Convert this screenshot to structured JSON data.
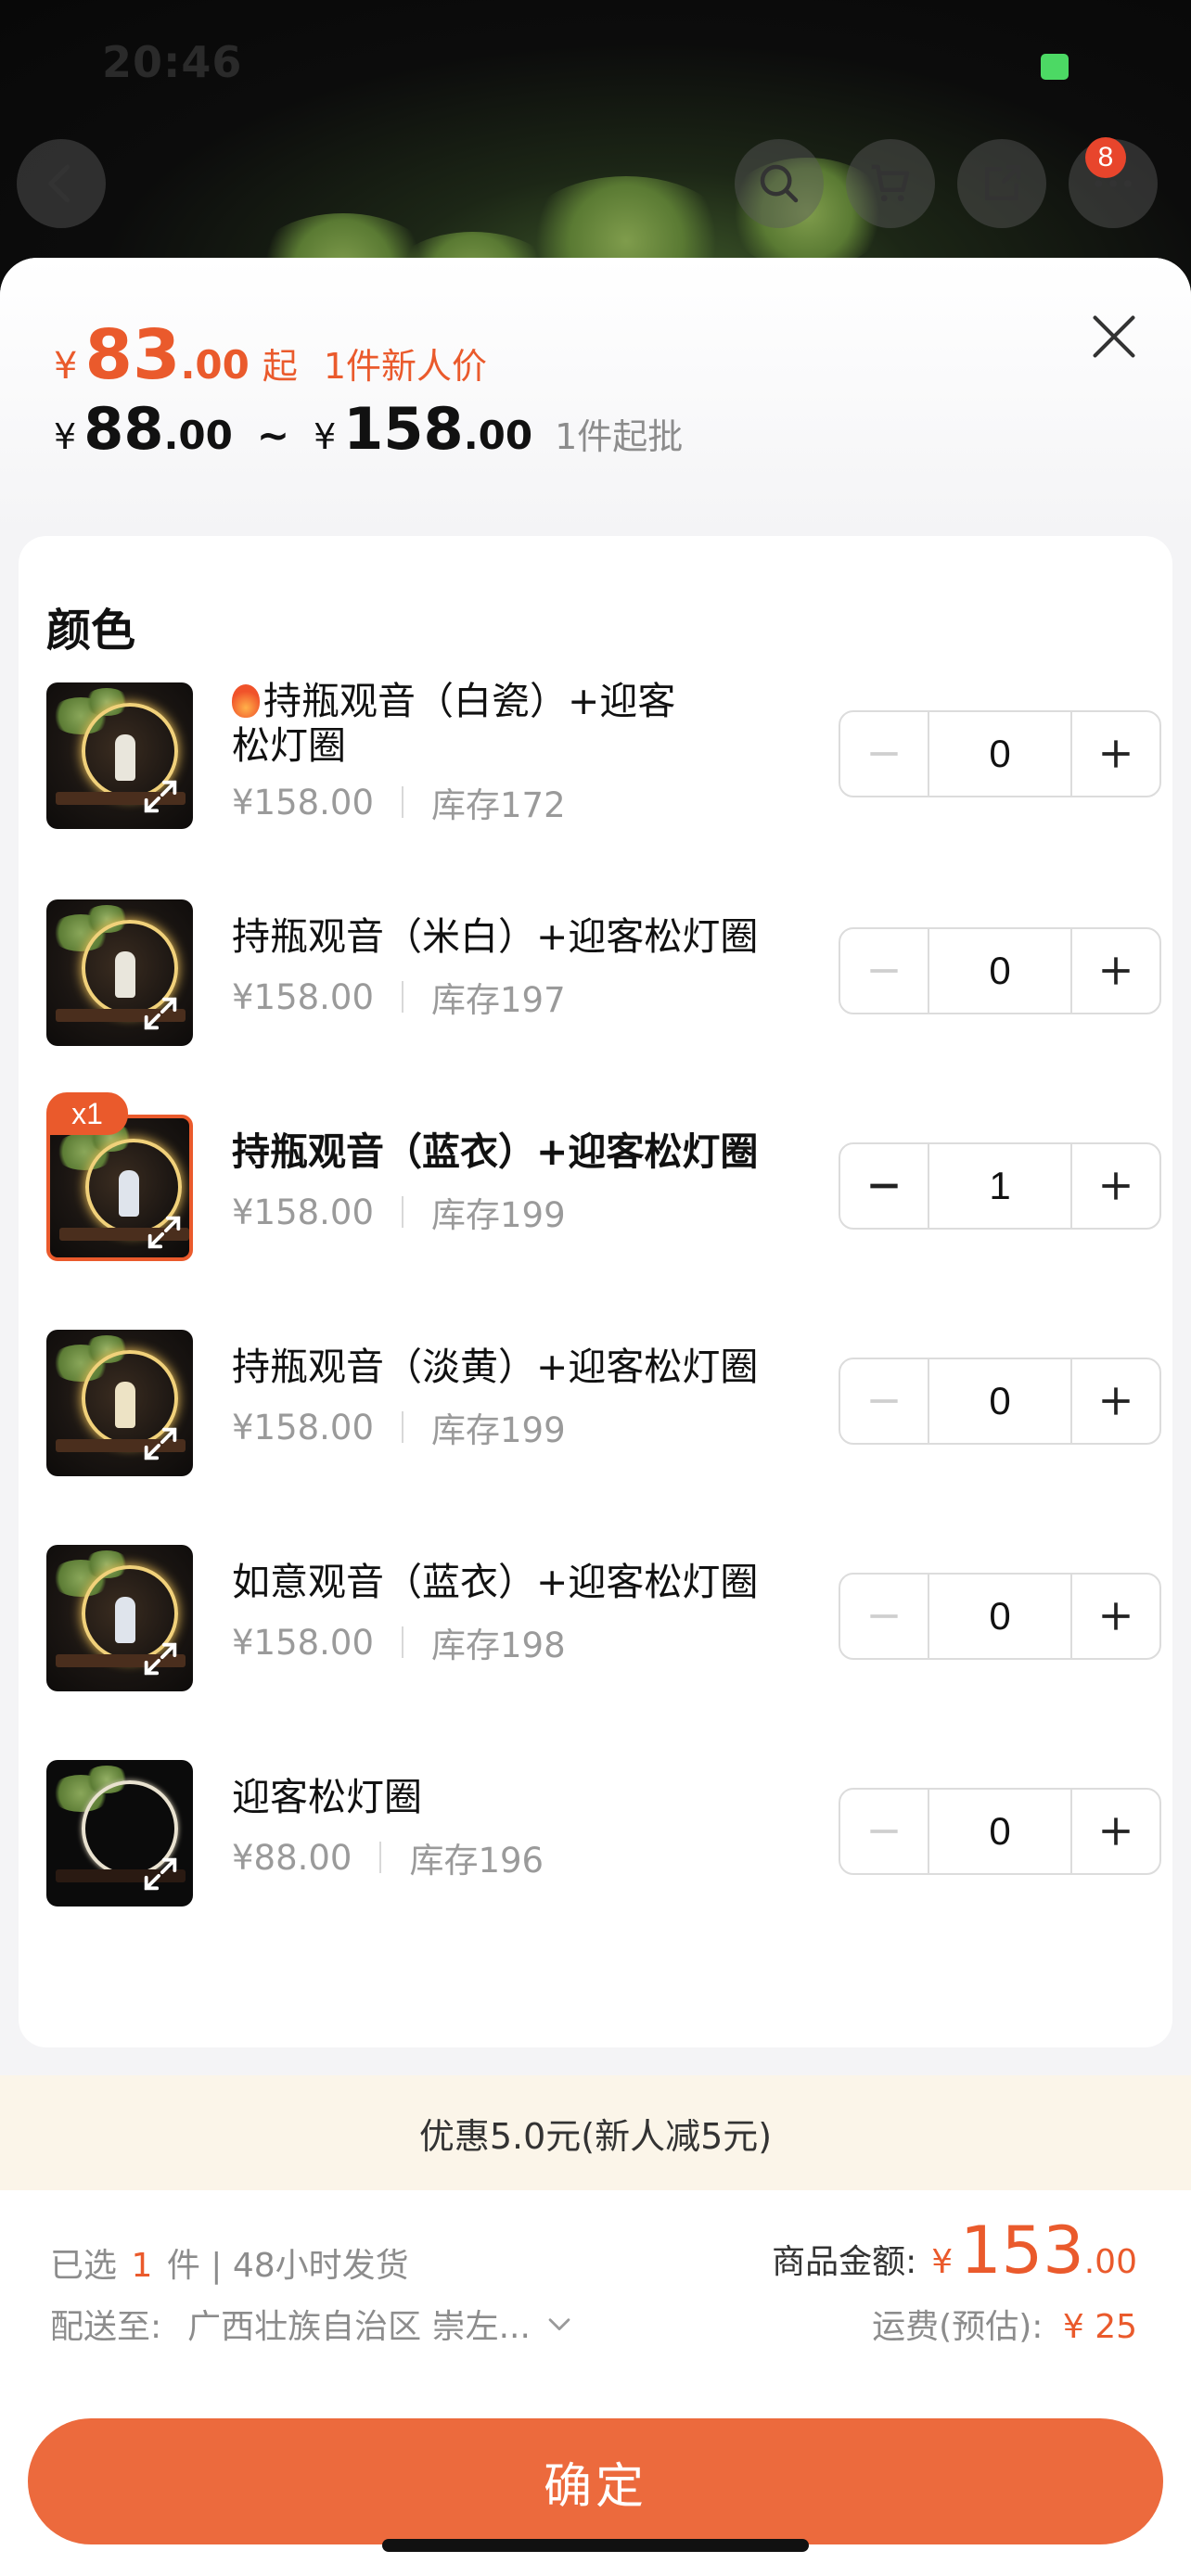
{
  "status_bar": {
    "time": "20:46"
  },
  "nav": {
    "cart_badge": "8"
  },
  "header": {
    "price_yen": "¥",
    "price_int": "83",
    "price_dec": ".00",
    "price_suffix": "起",
    "price_tag": "1件新人价",
    "range_yen1": "¥",
    "range_low_int": "88",
    "range_low_dec": ".00",
    "range_sep": "~",
    "range_yen2": "¥",
    "range_high_int": "158",
    "range_high_dec": ".00",
    "moq": "1件起批"
  },
  "section_title": "颜色",
  "variants": [
    {
      "name": "持瓶观音（白瓷）+迎客松灯圈",
      "price": "¥158.00",
      "stock": "库存172",
      "qty": "0",
      "hot": true
    },
    {
      "name": "持瓶观音（米白）+迎客松灯圈",
      "price": "¥158.00",
      "stock": "库存197",
      "qty": "0"
    },
    {
      "name": "持瓶观音（蓝衣）+迎客松灯圈",
      "price": "¥158.00",
      "stock": "库存199",
      "qty": "1",
      "badge": "x1",
      "selected": true
    },
    {
      "name": "持瓶观音（淡黄）+迎客松灯圈",
      "price": "¥158.00",
      "stock": "库存199",
      "qty": "0"
    },
    {
      "name": "如意观音（蓝衣）+迎客松灯圈",
      "price": "¥158.00",
      "stock": "库存198",
      "qty": "0"
    },
    {
      "name": "迎客松灯圈",
      "price": "¥88.00",
      "stock": "库存196",
      "qty": "0"
    }
  ],
  "discount": "优惠5.0元(新人减5元)",
  "footer": {
    "selected_prefix": "已选",
    "selected_count": "1",
    "selected_suffix": "件 | 48小时发货",
    "amount_label": "商品金额:",
    "amount_yen": "¥",
    "amount_int": "153",
    "amount_dec": ".00",
    "ship_label": "配送至:",
    "ship_addr": "广西壮族自治区 崇左...",
    "freight_label": "运费(预估):",
    "freight_value": "¥ 25",
    "confirm": "确定"
  },
  "colors": {
    "accent": "#ea5a2c",
    "button": "#ec6a3d",
    "discount_bg": "#fbf5e9"
  }
}
